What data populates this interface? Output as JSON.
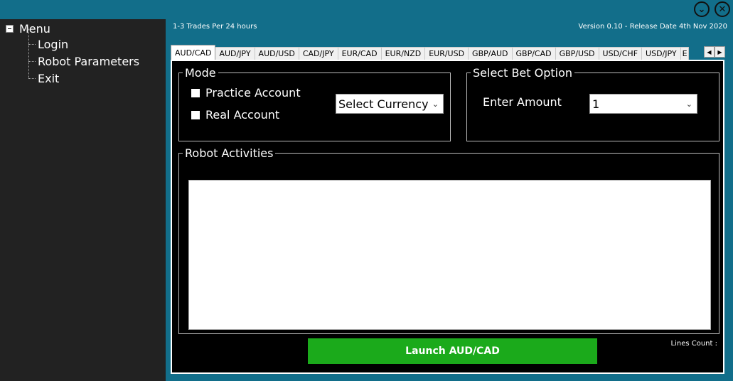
{
  "window": {
    "minimize_glyph": "⌄",
    "close_glyph": "✕"
  },
  "header": {
    "left_text": "1-3 Trades Per 24 hours",
    "right_text": "Version 0.10 - Release Date 4th Nov 2020"
  },
  "sidebar": {
    "root_label": "Menu",
    "items": [
      {
        "label": "Login"
      },
      {
        "label": "Robot Parameters"
      },
      {
        "label": "Exit"
      }
    ]
  },
  "tabs": [
    {
      "label": "AUD/CAD",
      "active": true
    },
    {
      "label": "AUD/JPY"
    },
    {
      "label": "AUD/USD"
    },
    {
      "label": "CAD/JPY"
    },
    {
      "label": "EUR/CAD"
    },
    {
      "label": "EUR/NZD"
    },
    {
      "label": "EUR/USD"
    },
    {
      "label": "GBP/AUD"
    },
    {
      "label": "GBP/CAD"
    },
    {
      "label": "GBP/USD"
    },
    {
      "label": "USD/CHF"
    },
    {
      "label": "USD/JPY"
    },
    {
      "label": "E"
    }
  ],
  "mode": {
    "legend": "Mode",
    "practice_label": "Practice Account",
    "real_label": "Real Account",
    "currency_select": "Select Currency"
  },
  "bet": {
    "legend": "Select Bet Option",
    "amount_label": "Enter Amount",
    "amount_value": "1"
  },
  "activities": {
    "legend": "Robot Activities"
  },
  "launch_label": "Launch AUD/CAD",
  "lines_count_label": "Lines Count :",
  "colors": {
    "background": "#126E8A",
    "sidebar": "#222222",
    "launch_button": "#1BAA1B"
  }
}
